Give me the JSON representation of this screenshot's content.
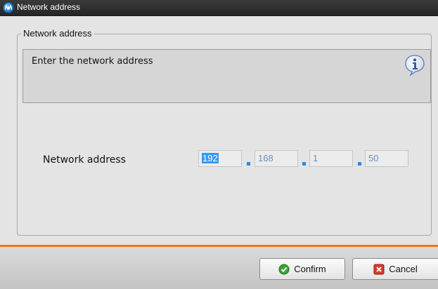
{
  "window": {
    "title": "Network address",
    "icon": "app-logo-icon"
  },
  "group": {
    "legend": "Network address"
  },
  "info": {
    "text": "Enter the network address",
    "icon": "info-icon"
  },
  "address": {
    "label": "Network address",
    "octets": [
      "192",
      "168",
      "1",
      "50"
    ],
    "selected_octet": 0
  },
  "buttons": {
    "confirm": {
      "label": "Confirm",
      "icon": "check-icon"
    },
    "cancel": {
      "label": "Cancel",
      "icon": "cancel-x-icon"
    }
  },
  "colors": {
    "accent_bar": "#f07622",
    "selection": "#3399ff",
    "titlebar": "#2e2e2e"
  }
}
